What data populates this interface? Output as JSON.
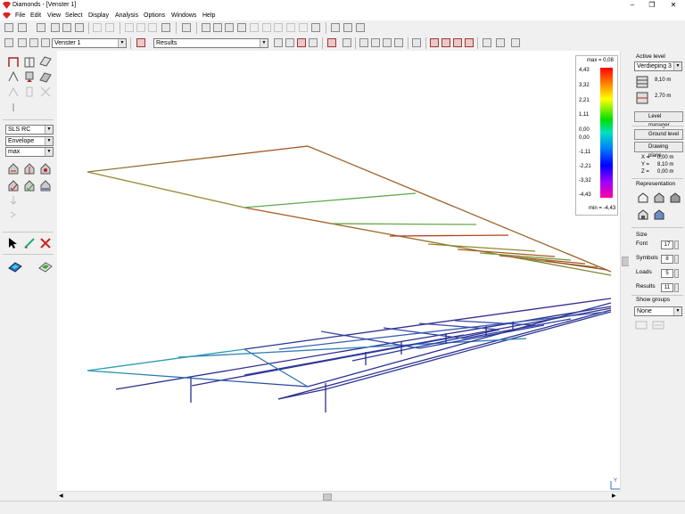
{
  "window": {
    "title": "Diamonds - [Venster 1]",
    "minimize": "–",
    "maximize": "❐",
    "close": "✕"
  },
  "menu": [
    "File",
    "Edit",
    "View",
    "Select",
    "Display",
    "Analysis",
    "Options",
    "Windows",
    "Help"
  ],
  "toolbar": {
    "window_combo": "Venster 1",
    "results_combo": "Results"
  },
  "left": {
    "combination": "SLS RC",
    "envelope": "Envelope",
    "extreme": "max"
  },
  "legend": {
    "max_label": "max = 0,08",
    "min_label": "min = -4,43",
    "ticks": [
      "4,43",
      "3,32",
      "2,21",
      "1,11",
      "0,00",
      "0,00",
      "-1,11",
      "-2,21",
      "-3,32",
      "-4,43"
    ]
  },
  "right": {
    "active_level_title": "Active level",
    "active_level": "Verdieping 3",
    "level_height": "8,10 m",
    "level_spacing": "2,70 m",
    "level_manager": "Level manager",
    "ground_level": "Ground level",
    "drawing_plane": "Drawing plane",
    "coords": {
      "x_label": "X =",
      "x": "0,00 m",
      "y_label": "Y =",
      "y": "8,10 m",
      "z_label": "Z =",
      "z": "0,00 m"
    },
    "representation_title": "Representation",
    "size_title": "Size",
    "sizes": [
      {
        "label": "Font",
        "value": "17"
      },
      {
        "label": "Symbols",
        "value": "8"
      },
      {
        "label": "Loads",
        "value": "5"
      },
      {
        "label": "Results",
        "value": "11"
      }
    ],
    "show_groups_title": "Show groups",
    "show_groups": "None"
  },
  "axis_gizmo": {
    "y": "Y",
    "z": "Z"
  }
}
